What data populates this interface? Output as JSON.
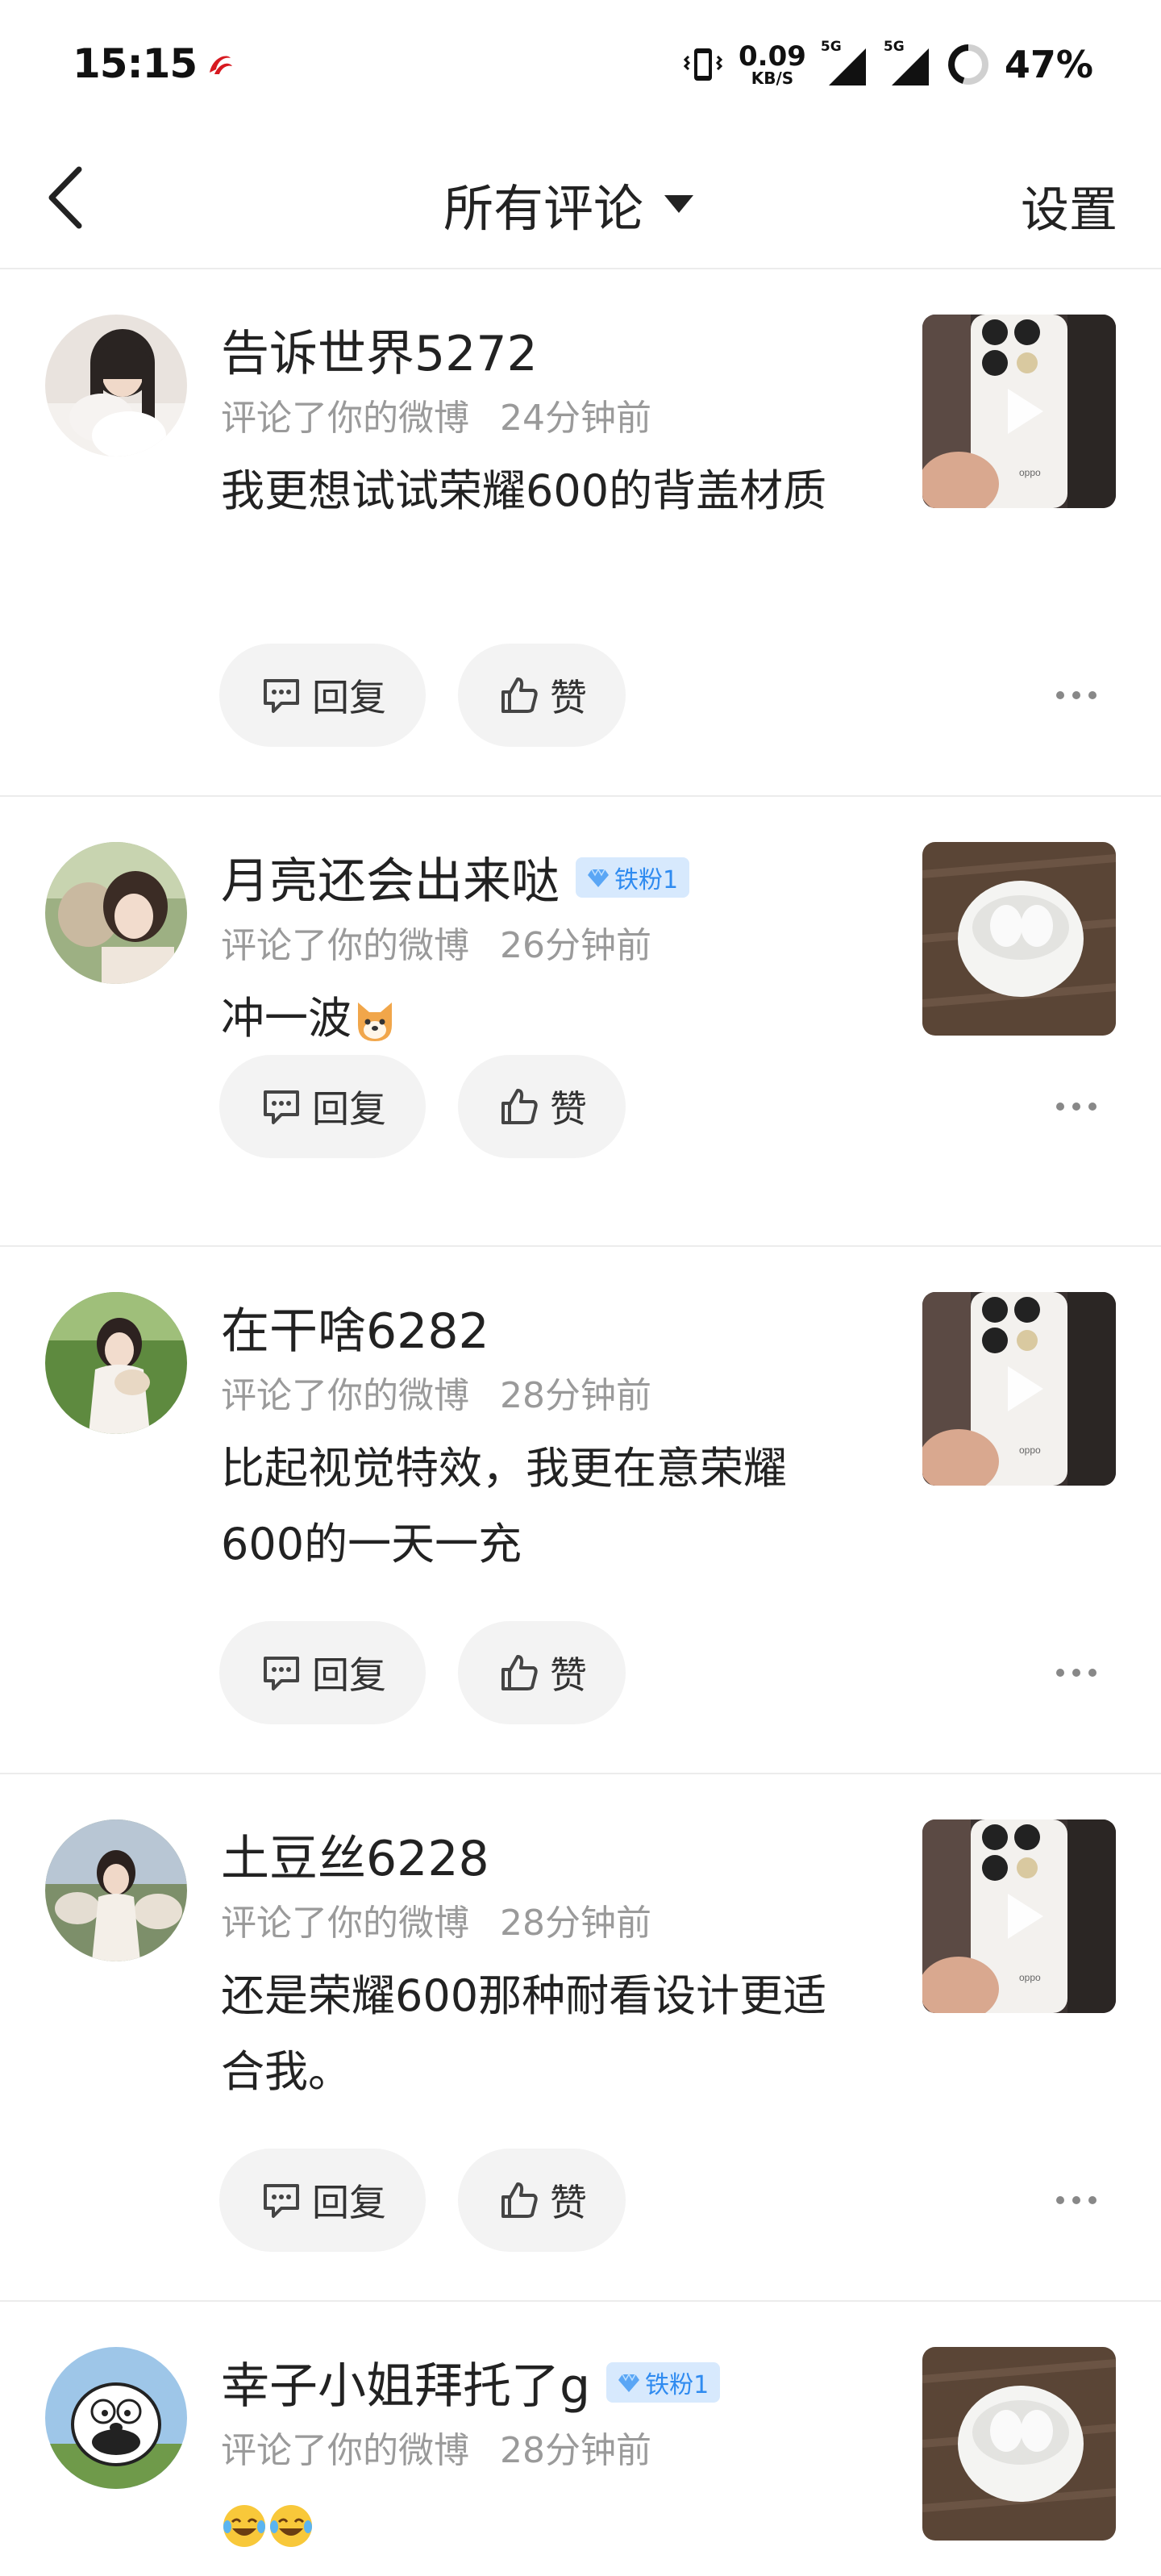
{
  "status_bar": {
    "time": "15:15",
    "net_speed": "0.09",
    "net_unit": "KB/S",
    "sim1": "5G",
    "sim2": "5G",
    "battery": "47%",
    "icons": [
      "airline-logo-icon",
      "vibrate-icon",
      "signal-icon",
      "battery-ring-icon"
    ]
  },
  "nav": {
    "back_icon": "chevron-left-icon",
    "title": "所有评论",
    "dropdown_icon": "caret-down-icon",
    "settings": "设置"
  },
  "comments": [
    {
      "user": "告诉世界5272",
      "badge": "",
      "action": "评论了你的微博",
      "time": "24分钟前",
      "text": "我更想试试荣耀600的背盖材质",
      "emoji": [],
      "thumb": "phone-video",
      "reply_label": "回复",
      "like_label": "赞"
    },
    {
      "user": "月亮还会出来哒",
      "badge": "铁粉1",
      "action": "评论了你的微博",
      "time": "26分钟前",
      "text": "冲一波",
      "emoji": [
        "dog-face-emoji"
      ],
      "thumb": "earbuds",
      "reply_label": "回复",
      "like_label": "赞"
    },
    {
      "user": "在干啥6282",
      "badge": "",
      "action": "评论了你的微博",
      "time": "28分钟前",
      "text": "比起视觉特效，我更在意荣耀600的一天一充",
      "emoji": [],
      "thumb": "phone-video",
      "reply_label": "回复",
      "like_label": "赞"
    },
    {
      "user": "土豆丝6228",
      "badge": "",
      "action": "评论了你的微博",
      "time": "28分钟前",
      "text": "还是荣耀600那种耐看设计更适合我。",
      "emoji": [],
      "thumb": "phone-video",
      "reply_label": "回复",
      "like_label": "赞"
    },
    {
      "user": "幸子小姐拜托了g",
      "badge": "铁粉1",
      "action": "评论了你的微博",
      "time": "28分钟前",
      "text": "",
      "emoji": [
        "laughing-tears-emoji",
        "laughing-tears-emoji"
      ],
      "thumb": "earbuds",
      "reply_label": "回复",
      "like_label": "赞"
    }
  ],
  "colors": {
    "badge_bg": "#d7e9fd",
    "badge_text": "#2f8bf0",
    "meta": "#9a9a9a",
    "pill_bg": "#f3f3f3"
  }
}
